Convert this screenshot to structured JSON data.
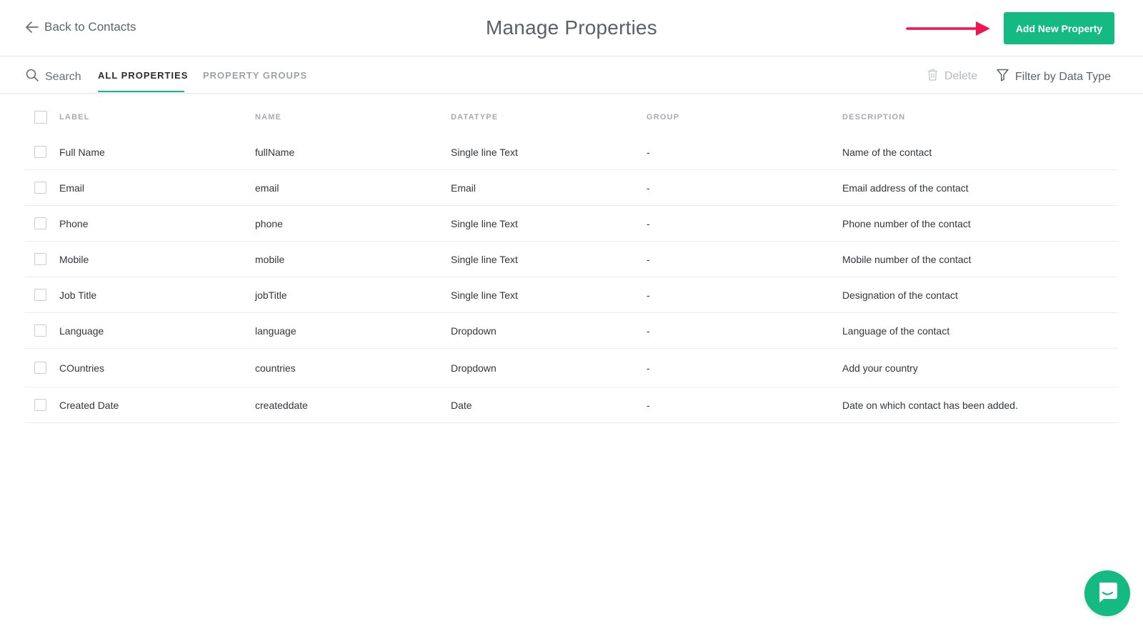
{
  "header": {
    "back_label": "Back to Contacts",
    "title": "Manage Properties",
    "add_button_label": "Add New Property"
  },
  "toolbar": {
    "search_label": "Search",
    "tabs": [
      {
        "label": "ALL PROPERTIES",
        "active": true
      },
      {
        "label": "PROPERTY GROUPS",
        "active": false
      }
    ],
    "delete_label": "Delete",
    "filter_label": "Filter by Data Type"
  },
  "table": {
    "columns": [
      "LABEL",
      "NAME",
      "DATATYPE",
      "GROUP",
      "DESCRIPTION"
    ],
    "rows": [
      {
        "label": "Full Name",
        "name": "fullName",
        "datatype": "Single line Text",
        "group": "-",
        "description": "Name of the contact"
      },
      {
        "label": "Email",
        "name": "email",
        "datatype": "Email",
        "group": "-",
        "description": "Email address of the contact"
      },
      {
        "label": "Phone",
        "name": "phone",
        "datatype": "Single line Text",
        "group": "-",
        "description": "Phone number of the contact"
      },
      {
        "label": "Mobile",
        "name": "mobile",
        "datatype": "Single line Text",
        "group": "-",
        "description": "Mobile number of the contact"
      },
      {
        "label": "Job Title",
        "name": "jobTitle",
        "datatype": "Single line Text",
        "group": "-",
        "description": "Designation of the contact"
      },
      {
        "label": "Language",
        "name": "language",
        "datatype": "Dropdown",
        "group": "-",
        "description": "Language of the contact"
      },
      {
        "label": "COuntries",
        "name": "countries",
        "datatype": "Dropdown",
        "group": "-",
        "description": "Add your country"
      },
      {
        "label": "Created Date",
        "name": "createddate",
        "datatype": "Date",
        "group": "-",
        "description": "Date on which contact has been added."
      }
    ]
  },
  "icons": {
    "back": "arrow-left-icon",
    "search": "search-icon",
    "delete": "trash-icon",
    "filter": "filter-icon",
    "chat": "chat-icon",
    "annotation": "red-arrow-icon"
  },
  "colors": {
    "accent": "#15b982",
    "annotation": "#f0144f"
  }
}
